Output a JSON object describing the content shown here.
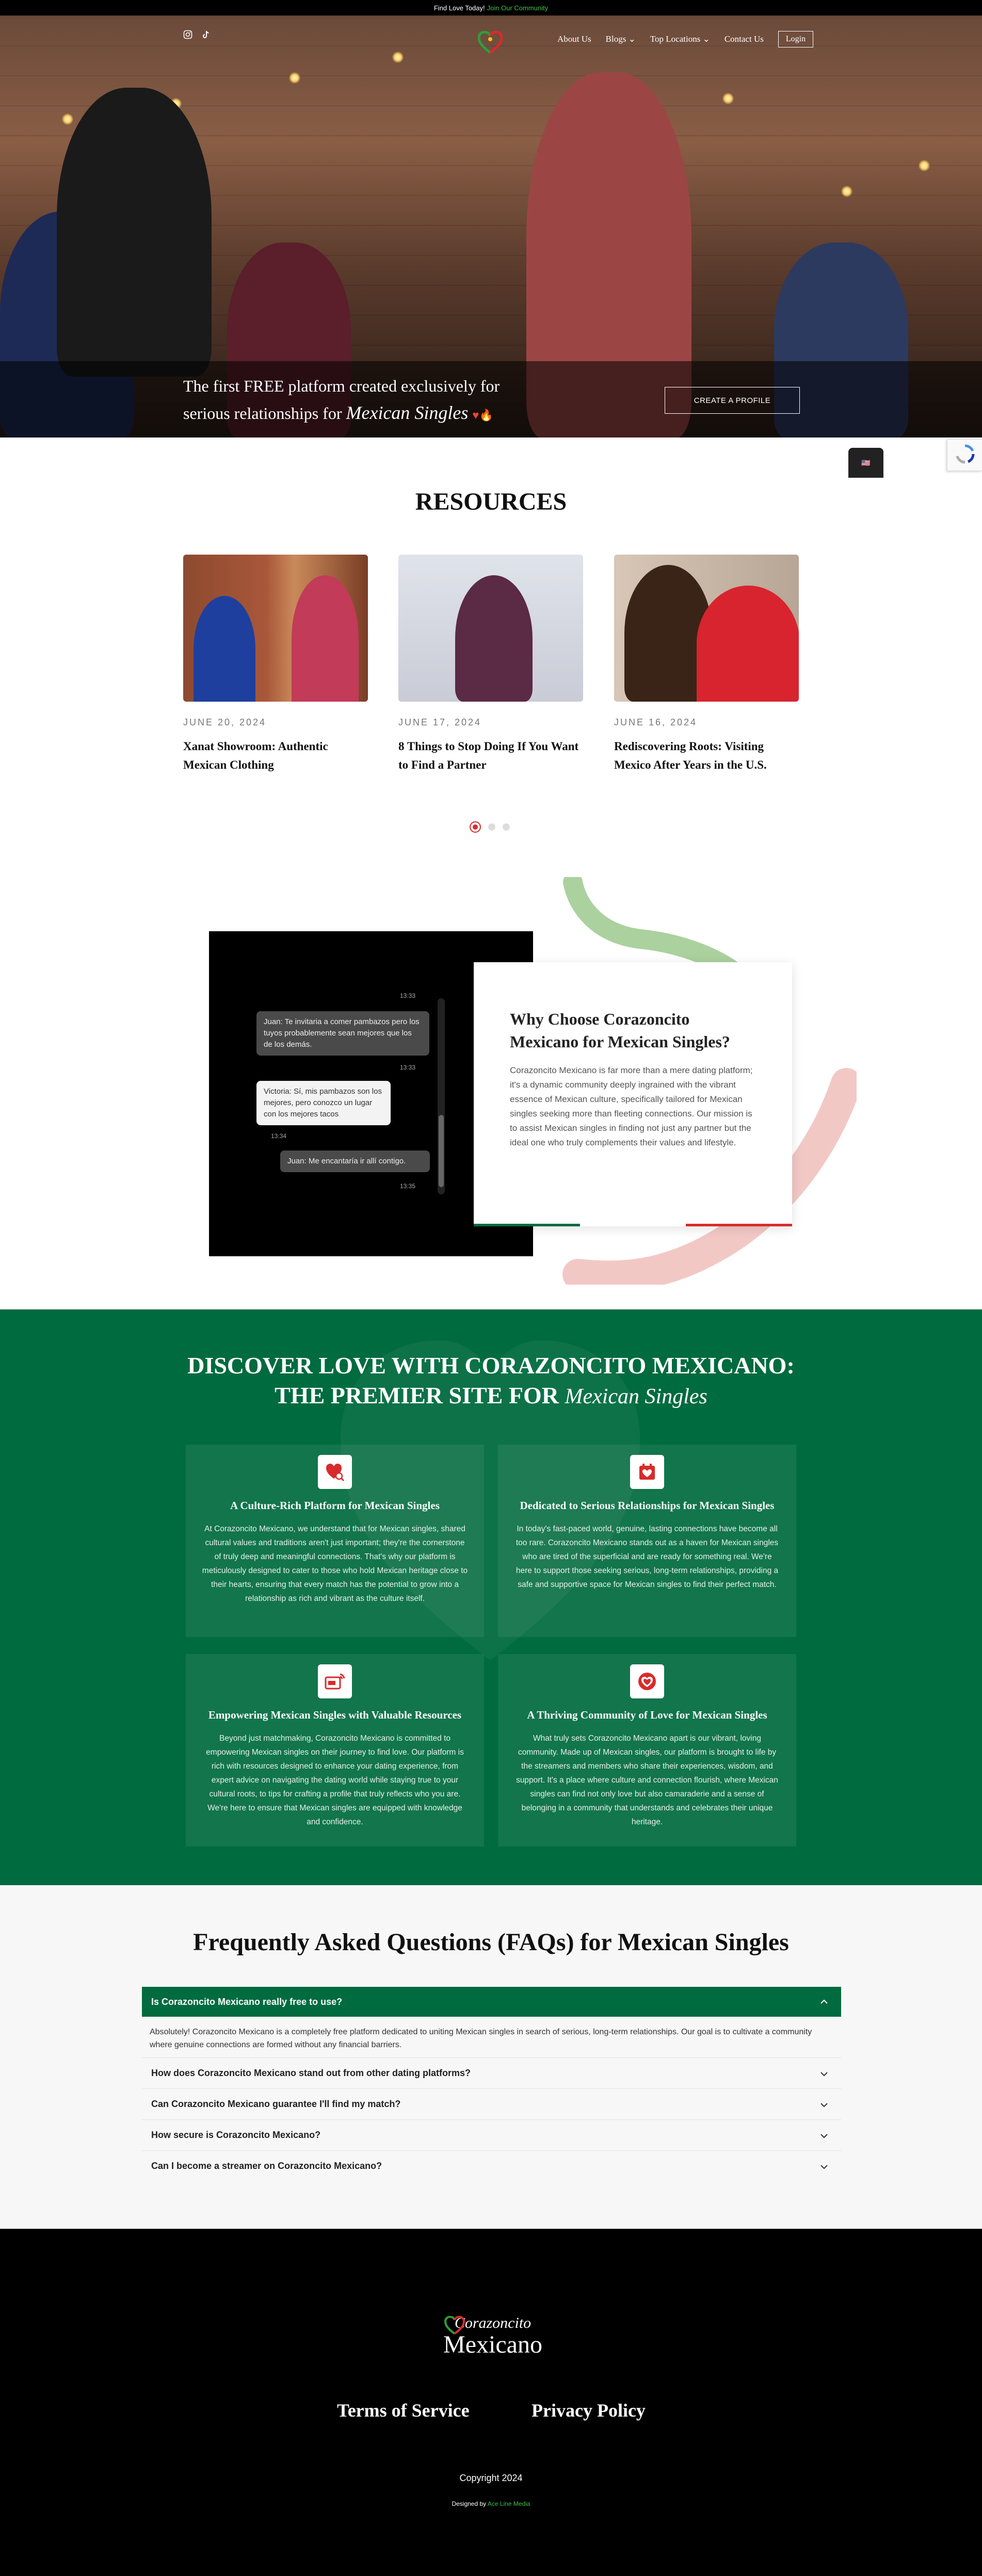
{
  "topbar": {
    "text": "Find Love Today!",
    "link": "Join Our Community"
  },
  "nav": {
    "links": [
      "About Us",
      "Blogs ⌄",
      "Top Locations ⌄",
      "Contact Us"
    ],
    "login": "Login"
  },
  "hero": {
    "line1": "The first FREE platform created exclusively for",
    "line2": "serious relationships for",
    "script": "Mexican Singles",
    "cta": "CREATE A PROFILE"
  },
  "resources": {
    "title": "RESOURCES",
    "posts": [
      {
        "date": "JUNE 20, 2024",
        "title": "Xanat Showroom: Authentic Mexican Clothing"
      },
      {
        "date": "JUNE 17, 2024",
        "title": "8 Things to Stop Doing If You Want to Find a Partner"
      },
      {
        "date": "JUNE 16, 2024",
        "title": "Rediscovering Roots: Visiting Mexico After Years in the U.S."
      }
    ]
  },
  "chat": {
    "ts1": "13:33",
    "m1": "Juan: Te invitaria a comer pambazos pero los tuyos probablemente sean mejores que los de los demás.",
    "ts2": "13:33",
    "m2": "Victoria: Sí, mis pambazos son los mejores, pero conozco un lugar con los mejores tacos",
    "ts3": "13:34",
    "m3": "Juan: Me encantaría ir allí contigo.",
    "ts4": "13:35"
  },
  "why": {
    "title": "Why Choose Corazoncito Mexicano for Mexican Singles?",
    "body": "Corazoncito Mexicano is far more than a mere dating platform; it's a dynamic community deeply ingrained with the vibrant essence of Mexican culture, specifically tailored for Mexican singles seeking more than fleeting connections. Our mission is to assist Mexican singles in finding not just any partner but the ideal one who truly complements their values and lifestyle."
  },
  "discover": {
    "line1": "DISCOVER LOVE WITH CORAZONCITO MEXICANO:",
    "line2": "THE PREMIER SITE FOR",
    "script": "Mexican Singles",
    "features": [
      {
        "icon": "heart-search-icon",
        "title": "A Culture-Rich Platform for Mexican Singles",
        "body": "At Corazoncito Mexicano, we understand that for Mexican singles, shared cultural values and traditions aren't just important; they're the cornerstone of truly deep and meaningful connections. That's why our platform is meticulously designed to cater to those who hold Mexican heritage close to their hearts, ensuring that every match has the potential to grow into a relationship as rich and vibrant as the culture itself."
      },
      {
        "icon": "calendar-heart-icon",
        "title": "Dedicated to Serious Relationships for Mexican Singles",
        "body": "In today's fast-paced world, genuine, lasting connections have become all too rare. Corazoncito Mexicano stands out as a haven for Mexican singles who are tired of the superficial and are ready for something real. We're here to support those seeking serious, long-term relationships, providing a safe and supportive space for Mexican singles to find their perfect match."
      },
      {
        "icon": "live-stream-icon",
        "title": "Empowering Mexican Singles with Valuable Resources",
        "body": "Beyond just matchmaking, Corazoncito Mexicano is committed to empowering Mexican singles on their journey to find love. Our platform is rich with resources designed to enhance your dating experience, from expert advice on navigating the dating world while staying true to your cultural roots, to tips for crafting a profile that truly reflects who you are. We're here to ensure that Mexican singles are equipped with knowledge and confidence."
      },
      {
        "icon": "heart-badge-icon",
        "title": "A Thriving Community of Love for Mexican Singles",
        "body": "What truly sets Corazoncito Mexicano apart is our vibrant, loving community. Made up of Mexican singles, our platform is brought to life by the streamers and members who share their experiences, wisdom, and support. It's a place where culture and connection flourish, where Mexican singles can find not only love but also camaraderie and a sense of belonging in a community that understands and celebrates their unique heritage."
      }
    ]
  },
  "faq": {
    "title": "Frequently Asked Questions (FAQs) for Mexican Singles",
    "open_q": "Is Corazoncito Mexicano really free to use?",
    "open_a": "Absolutely! Corazoncito Mexicano is a completely free platform dedicated to uniting Mexican singles in search of serious, long-term relationships. Our goal is to cultivate a community where genuine connections are formed without any financial barriers.",
    "questions": [
      "How does Corazoncito Mexicano stand out from other dating platforms?",
      "Can Corazoncito Mexicano guarantee I'll find my match?",
      "How secure is Corazoncito Mexicano?",
      "Can I become a streamer on Corazoncito Mexicano?"
    ]
  },
  "footer": {
    "logo_top": "Corazoncito",
    "logo_bottom": "Mexicano",
    "terms": "Terms of Service",
    "privacy": "Privacy Policy",
    "copyright": "Copyright 2024",
    "designed_by": "Designed by",
    "designer": "Ace Line Media"
  },
  "colors": {
    "green": "#006b3f",
    "red": "#d92b2b",
    "link_green": "#3fbf4a"
  }
}
